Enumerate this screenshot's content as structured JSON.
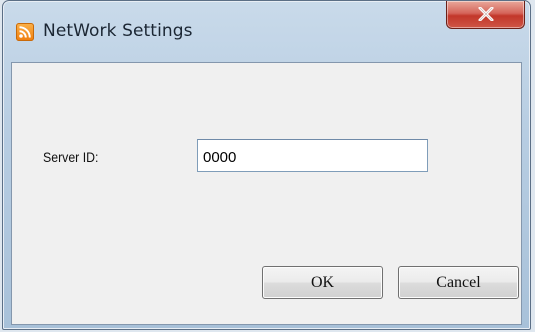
{
  "window": {
    "title": "NetWork Settings",
    "icon": "rss-feed-icon",
    "close_icon": "close-icon"
  },
  "form": {
    "server_id_label": "Server ID:",
    "server_id_value": "0000"
  },
  "buttons": {
    "ok_label": "OK",
    "cancel_label": "Cancel"
  },
  "colors": {
    "close_button": "#c2372a",
    "app_icon": "#f07d0c",
    "titlebar": "#b7cde2",
    "client_area": "#f0f0f0"
  }
}
